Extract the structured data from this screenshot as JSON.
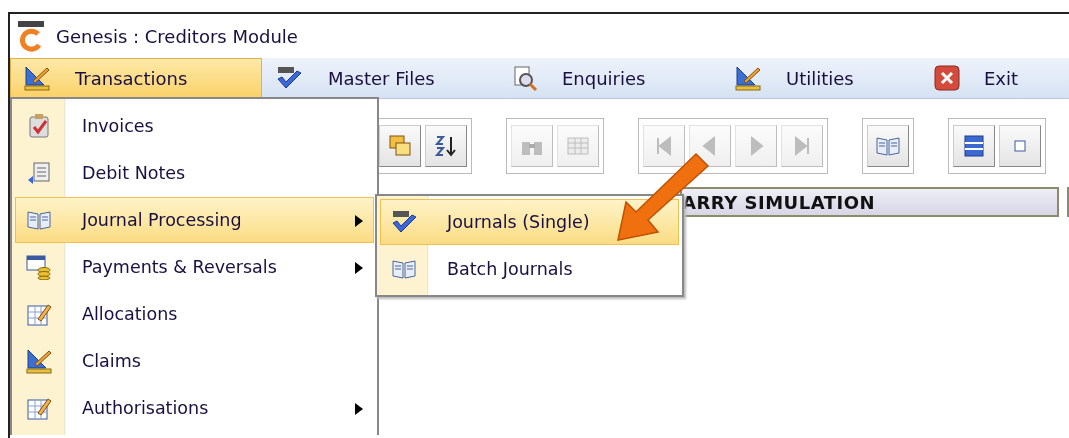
{
  "window": {
    "title": "Genesis : Creditors Module"
  },
  "menu_bar": [
    {
      "label": "Transactions",
      "selected": true
    },
    {
      "label": "Master Files",
      "selected": false
    },
    {
      "label": "Enquiries",
      "selected": false
    },
    {
      "label": "Utilities",
      "selected": false
    },
    {
      "label": "Exit",
      "selected": false
    }
  ],
  "toolbar": [
    {
      "buttons": [
        {
          "disabled": false
        },
        {
          "disabled": false
        }
      ]
    },
    {
      "buttons": [
        {
          "disabled": true
        },
        {
          "disabled": true
        }
      ]
    },
    {
      "buttons": [
        {
          "disabled": true
        },
        {
          "disabled": true
        },
        {
          "disabled": true
        },
        {
          "disabled": true
        }
      ]
    },
    {
      "buttons": [
        {
          "disabled": false
        }
      ]
    },
    {
      "buttons": [
        {
          "disabled": false
        },
        {
          "disabled": false
        }
      ]
    }
  ],
  "header": {
    "title": "ARRY SIMULATION"
  },
  "dropdown": [
    {
      "label": "Invoices",
      "submenu": false,
      "selected": false
    },
    {
      "label": "Debit Notes",
      "submenu": false,
      "selected": false
    },
    {
      "label": "Journal Processing",
      "submenu": true,
      "selected": true
    },
    {
      "label": "Payments & Reversals",
      "submenu": true,
      "selected": false
    },
    {
      "label": "Allocations",
      "submenu": false,
      "selected": false
    },
    {
      "label": "Claims",
      "submenu": false,
      "selected": false
    },
    {
      "label": "Authorisations",
      "submenu": true,
      "selected": false
    }
  ],
  "submenu": [
    {
      "label": "Journals (Single)",
      "selected": true
    },
    {
      "label": "Batch Journals",
      "selected": false
    }
  ]
}
